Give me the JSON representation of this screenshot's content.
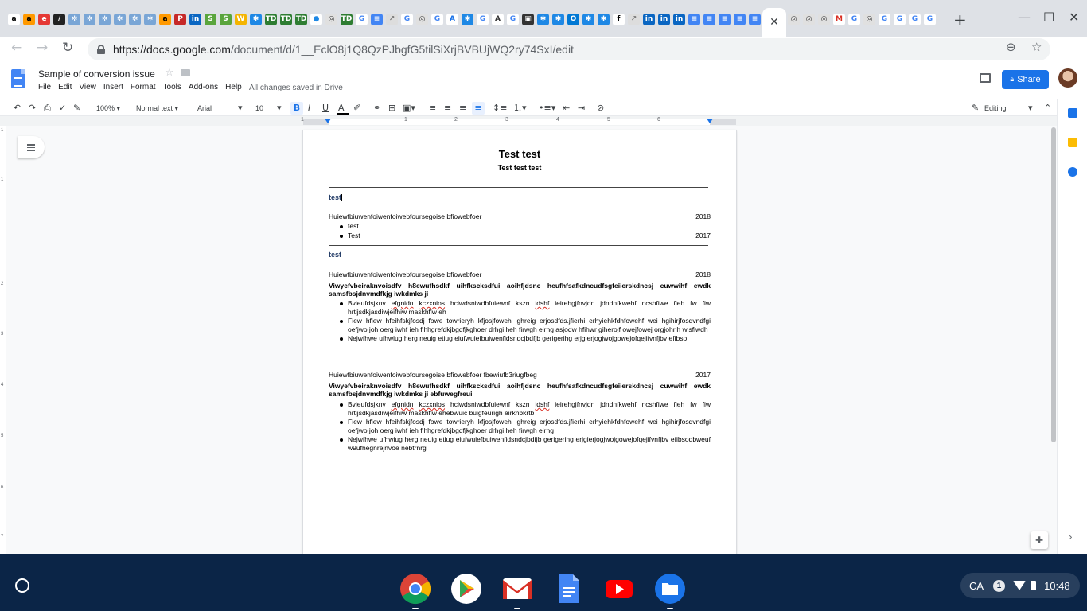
{
  "browser": {
    "tabs_favicons": [
      {
        "glyph": "a",
        "bg": "#ffffff",
        "fg": "#000000"
      },
      {
        "glyph": "a",
        "bg": "#ff9900",
        "fg": "#000000"
      },
      {
        "glyph": "e",
        "bg": "#e53935",
        "fg": "#ffffff"
      },
      {
        "glyph": "/",
        "bg": "#222222",
        "fg": "#ffffff"
      },
      {
        "glyph": "✲",
        "bg": "#7aa6d6",
        "fg": "#ffffff"
      },
      {
        "glyph": "✲",
        "bg": "#7aa6d6",
        "fg": "#ffffff"
      },
      {
        "glyph": "✲",
        "bg": "#7aa6d6",
        "fg": "#ffffff"
      },
      {
        "glyph": "✲",
        "bg": "#7aa6d6",
        "fg": "#ffffff"
      },
      {
        "glyph": "✲",
        "bg": "#7aa6d6",
        "fg": "#ffffff"
      },
      {
        "glyph": "✲",
        "bg": "#7aa6d6",
        "fg": "#ffffff"
      },
      {
        "glyph": "a",
        "bg": "#ff9900",
        "fg": "#000000"
      },
      {
        "glyph": "P",
        "bg": "#c62828",
        "fg": "#ffffff"
      },
      {
        "glyph": "in",
        "bg": "#0a66c2",
        "fg": "#ffffff"
      },
      {
        "glyph": "S",
        "bg": "#5aa53d",
        "fg": "#ffffff"
      },
      {
        "glyph": "S",
        "bg": "#5aa53d",
        "fg": "#ffffff"
      },
      {
        "glyph": "W",
        "bg": "#f4b400",
        "fg": "#ffffff"
      },
      {
        "glyph": "✱",
        "bg": "#1e88e5",
        "fg": "#ffffff"
      },
      {
        "glyph": "TD",
        "bg": "#2e7d32",
        "fg": "#ffffff"
      },
      {
        "glyph": "TD",
        "bg": "#2e7d32",
        "fg": "#ffffff"
      },
      {
        "glyph": "TD",
        "bg": "#2e7d32",
        "fg": "#ffffff"
      },
      {
        "glyph": "●",
        "bg": "#ffffff",
        "fg": "#1e88e5"
      },
      {
        "glyph": "◎",
        "bg": "#e0e0e0",
        "fg": "#333333"
      },
      {
        "glyph": "TD",
        "bg": "#2e7d32",
        "fg": "#ffffff"
      },
      {
        "glyph": "G",
        "bg": "#ffffff",
        "fg": "#4285f4"
      },
      {
        "glyph": "≡",
        "bg": "#4285f4",
        "fg": "#ffffff"
      },
      {
        "glyph": "↗",
        "bg": "#dddddd",
        "fg": "#777777"
      },
      {
        "glyph": "G",
        "bg": "#ffffff",
        "fg": "#4285f4"
      },
      {
        "glyph": "◎",
        "bg": "#e0e0e0",
        "fg": "#333333"
      },
      {
        "glyph": "G",
        "bg": "#ffffff",
        "fg": "#4285f4"
      },
      {
        "glyph": "A",
        "bg": "#ffffff",
        "fg": "#1a73e8"
      },
      {
        "glyph": "✱",
        "bg": "#1e88e5",
        "fg": "#ffffff"
      },
      {
        "glyph": "G",
        "bg": "#ffffff",
        "fg": "#4285f4"
      },
      {
        "glyph": "A",
        "bg": "#ffffff",
        "fg": "#333333"
      },
      {
        "glyph": "G",
        "bg": "#ffffff",
        "fg": "#4285f4"
      },
      {
        "glyph": "▣",
        "bg": "#333333",
        "fg": "#ffffff"
      },
      {
        "glyph": "✱",
        "bg": "#1e88e5",
        "fg": "#ffffff"
      },
      {
        "glyph": "✱",
        "bg": "#1e88e5",
        "fg": "#ffffff"
      },
      {
        "glyph": "O",
        "bg": "#0078d4",
        "fg": "#ffffff"
      },
      {
        "glyph": "✱",
        "bg": "#1e88e5",
        "fg": "#ffffff"
      },
      {
        "glyph": "✱",
        "bg": "#1e88e5",
        "fg": "#ffffff"
      },
      {
        "glyph": "f",
        "bg": "#ffffff",
        "fg": "#000000"
      },
      {
        "glyph": "↗",
        "bg": "#dddddd",
        "fg": "#777777"
      },
      {
        "glyph": "in",
        "bg": "#0a66c2",
        "fg": "#ffffff"
      },
      {
        "glyph": "in",
        "bg": "#0a66c2",
        "fg": "#ffffff"
      },
      {
        "glyph": "in",
        "bg": "#0a66c2",
        "fg": "#ffffff"
      },
      {
        "glyph": "≡",
        "bg": "#4285f4",
        "fg": "#ffffff"
      },
      {
        "glyph": "≡",
        "bg": "#4285f4",
        "fg": "#ffffff"
      },
      {
        "glyph": "≡",
        "bg": "#4285f4",
        "fg": "#ffffff"
      },
      {
        "glyph": "≡",
        "bg": "#4285f4",
        "fg": "#ffffff"
      },
      {
        "glyph": "≡",
        "bg": "#4285f4",
        "fg": "#ffffff"
      }
    ],
    "tabs_after": [
      {
        "glyph": "◎",
        "bg": "#e0e0e0",
        "fg": "#333333"
      },
      {
        "glyph": "◎",
        "bg": "#e0e0e0",
        "fg": "#333333"
      },
      {
        "glyph": "◎",
        "bg": "#e0e0e0",
        "fg": "#333333"
      },
      {
        "glyph": "M",
        "bg": "#ffffff",
        "fg": "#d93025"
      },
      {
        "glyph": "G",
        "bg": "#ffffff",
        "fg": "#4285f4"
      },
      {
        "glyph": "◎",
        "bg": "#e0e0e0",
        "fg": "#333333"
      },
      {
        "glyph": "G",
        "bg": "#ffffff",
        "fg": "#4285f4"
      },
      {
        "glyph": "G",
        "bg": "#ffffff",
        "fg": "#4285f4"
      },
      {
        "glyph": "G",
        "bg": "#ffffff",
        "fg": "#4285f4"
      },
      {
        "glyph": "G",
        "bg": "#ffffff",
        "fg": "#4285f4"
      }
    ],
    "active_tab_close": "✕",
    "new_tab": "+",
    "minimize": "—",
    "maximize": "☐",
    "close": "✕",
    "url_host": "https://docs.google.com",
    "url_path": "/document/d/1__EclO8j1Q8QzPJbgfG5tilSiXrjBVBUjWQ2ry74SxI/edit"
  },
  "docs": {
    "title": "Sample of conversion issue",
    "menu": [
      "File",
      "Edit",
      "View",
      "Insert",
      "Format",
      "Tools",
      "Add-ons",
      "Help"
    ],
    "saved_status": "All changes saved in Drive",
    "share_label": "Share",
    "toolbar": {
      "zoom": "100%",
      "style": "Normal text",
      "font": "Arial",
      "size": "10",
      "mode": "Editing"
    },
    "ruler_numbers": [
      "1",
      "1",
      "2",
      "3",
      "4",
      "5",
      "6"
    ],
    "vruler_numbers": [
      "1",
      "1",
      "2",
      "3",
      "4",
      "5",
      "6",
      "7"
    ]
  },
  "document": {
    "title": "Test test",
    "subtitle": "Test test test",
    "section1": {
      "heading": "test",
      "entry": {
        "left": "Huiewfbiuwenfoiwenfoiwebfoursegoise bfiowebfoer",
        "right": "2018"
      },
      "bullets": [
        {
          "text": "test",
          "right": ""
        },
        {
          "text": "Test",
          "right": "2017"
        }
      ]
    },
    "section2": {
      "heading": "test",
      "entry1": {
        "left": "Huiewfbiuwenfoiwenfoiwebfoursegoise bfiowebfoer",
        "right": "2018",
        "bold": "Viwyefvbeiraknvoisdfv h8ewufhsdkf uihfkscksdfui aoihfjdsnc heufhfsafkdncudfsgfeiierskdncsj cuwwihf ewdk samsfbsjdnvmdfkjg iwkdmks ji",
        "b1_pre": "Bvieufdsjknv ",
        "b1_s1": "efgnidn",
        "b1_mid": " ",
        "b1_s2": "kczxnios",
        "b1_mid2": " hciwdsniwdbfuiewnf kszn ",
        "b1_s3": "idshf",
        "b1_post": " ieirehgjfnvjdn jdndnfkwehf ncshfiwe fieh fw fiw hrtijsdkjasdiwjeifhiw maskhfiw eh",
        "b2": "Fiew hfiew hfeihfskjfosdj fowe towrieryh kfjosjfoweh ighreig erjosdfds.jfierhi erhyiehkfdhfowehf wei hgihirjfosdvndfgi oefjwo joh oerg iwhf ieh fihhgrefdkjbgdfjkghoer drhgi heh firwgh eirhg asjodw hfihwr giherojf owejfowej orgjohrih wisfiwdh",
        "b3": "Nejwfhwe ufhwiug herg neuig etiug eiufwuiefbuiwenfidsndcjbdfjb gerigerihg erjgierjogjwojgowejofqejifvnfjbv efibso"
      },
      "entry2": {
        "left": "Huiewfbiuwenfoiwenfoiwebfoursegoise bfiowebfoer fbewiufb3riugfbeg",
        "right": "2017",
        "bold": "Viwyefvbeiraknvoisdfv h8ewufhsdkf uihfkscksdfui aoihfjdsnc heufhfsafkdncudfsgfeiierskdncsj cuwwihf ewdk samsfbsjdnvmdfkjg iwkdmks ji ebfuwegfreui",
        "b1_pre": "Bvieufdsjknv ",
        "b1_s1": "efgnidn",
        "b1_mid": " ",
        "b1_s2": "kczxnios",
        "b1_mid2": " hciwdsniwdbfuiewnf kszn ",
        "b1_s3": "idshf",
        "b1_post": " ieirehgjfnvjdn jdndnfkwehf ncshfiwe fieh fw fiw hrtijsdkjasdiwjeifhiw maskhfiw ehebwuic buigfeurigh eirknbkrtb",
        "b2": "Fiew hfiew hfeihfskjfosdj fowe towrieryh kfjosjfoweh ighreig erjosdfds.jfierhi erhyiehkfdhfowehf wei hgihirjfosdvndfgi oefjwo joh oerg iwhf ieh fihhgrefdkjbgdfjkghoer drhgi heh firwgh eirhg",
        "b3": "Nejwfhwe ufhwiug herg neuig etiug eiufwuiefbuiwenfidsndcjbdfjb gerigerihg erjgierjogjwojgowejofqejifvnfjbv efibsodbweuf w9ufhegnrejnvoe nebtrnrg"
      }
    }
  },
  "shelf": {
    "tray_locale": "CA",
    "notification_count": "1",
    "time": "10:48"
  }
}
